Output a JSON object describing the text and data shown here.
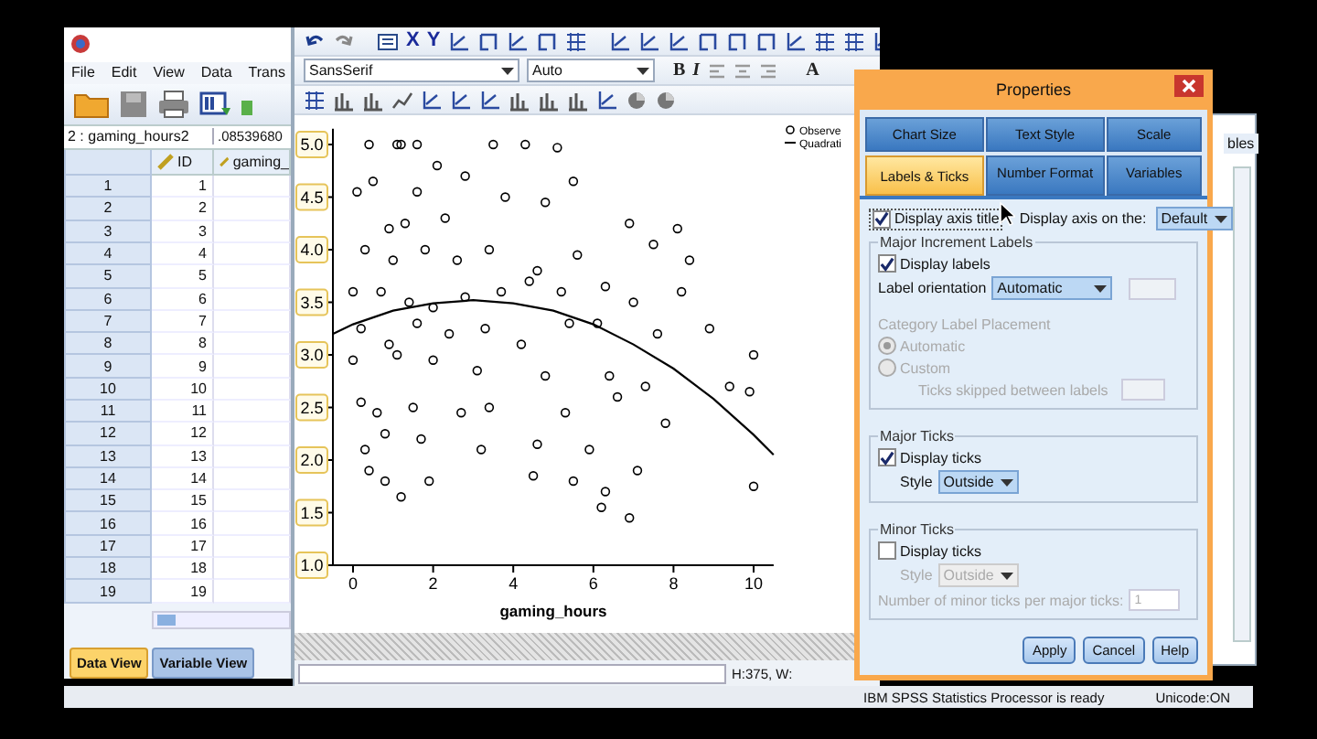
{
  "data_editor": {
    "menu": [
      "File",
      "Edit",
      "View",
      "Data",
      "Trans"
    ],
    "cell_ref": "2 : gaming_hours2",
    "cell_value": ".08539680",
    "columns": [
      "ID",
      "gaming_"
    ],
    "rows": [
      {
        "row": "1",
        "id": "1"
      },
      {
        "row": "2",
        "id": "2"
      },
      {
        "row": "3",
        "id": "3"
      },
      {
        "row": "4",
        "id": "4"
      },
      {
        "row": "5",
        "id": "5"
      },
      {
        "row": "6",
        "id": "6"
      },
      {
        "row": "7",
        "id": "7"
      },
      {
        "row": "8",
        "id": "8"
      },
      {
        "row": "9",
        "id": "9"
      },
      {
        "row": "10",
        "id": "10"
      },
      {
        "row": "11",
        "id": "11"
      },
      {
        "row": "12",
        "id": "12"
      },
      {
        "row": "13",
        "id": "13"
      },
      {
        "row": "14",
        "id": "14"
      },
      {
        "row": "15",
        "id": "15"
      },
      {
        "row": "16",
        "id": "16"
      },
      {
        "row": "17",
        "id": "17"
      },
      {
        "row": "18",
        "id": "18"
      },
      {
        "row": "19",
        "id": "19"
      }
    ],
    "view_tabs": [
      {
        "label": "Data View",
        "selected": true
      },
      {
        "label": "Variable View",
        "selected": false
      }
    ]
  },
  "chart_editor": {
    "axis_buttons": [
      "X",
      "Y"
    ],
    "font": "SansSerif",
    "size": "Auto",
    "style_buttons": [
      "B",
      "I"
    ],
    "color_button": "A",
    "y_labels_selected": true,
    "status": "H:375, W:",
    "chart_data": {
      "type": "scatter",
      "xlabel": "gaming_hours",
      "legend": "top-right",
      "xlim": [
        -0.5,
        10.5
      ],
      "ylim": [
        1,
        5.15
      ],
      "xticks": [
        0,
        2,
        4,
        6,
        8,
        10
      ],
      "yticks": [
        {
          "value": 1,
          "label": "1.0"
        },
        {
          "value": 1.5,
          "label": "1.5"
        },
        {
          "value": 2,
          "label": "2.0"
        },
        {
          "value": 2.5,
          "label": "2.5"
        },
        {
          "value": 3,
          "label": "3.0"
        },
        {
          "value": 3.5,
          "label": "3.5"
        },
        {
          "value": 4,
          "label": "4.0"
        },
        {
          "value": 4.5,
          "label": "4.5"
        },
        {
          "value": 5,
          "label": "5.0"
        }
      ],
      "series": [
        {
          "name": "Observe",
          "type": "scatter",
          "color": "#000000",
          "x": [
            0.4,
            1.1,
            1.2,
            1.6,
            3.5,
            4.3,
            5.1,
            2.1,
            0.1,
            0.5,
            1.6,
            2.8,
            5.5,
            3.8,
            0.9,
            1.3,
            2.3,
            4.8,
            6.9,
            8.1,
            0.3,
            1.0,
            1.8,
            2.6,
            3.4,
            4.6,
            5.6,
            7.5,
            8.4,
            0.0,
            0.7,
            1.4,
            2.0,
            2.8,
            3.7,
            4.4,
            5.2,
            6.3,
            7.0,
            8.2,
            0.2,
            0.9,
            1.6,
            2.4,
            3.3,
            4.2,
            5.4,
            6.1,
            7.6,
            8.9,
            0.0,
            1.1,
            2.0,
            3.1,
            4.8,
            6.4,
            7.3,
            9.4,
            9.9,
            10.0,
            0.2,
            0.6,
            1.5,
            2.7,
            3.4,
            5.3,
            6.6,
            7.8,
            0.3,
            0.8,
            1.7,
            3.2,
            4.6,
            5.9,
            7.1,
            0.4,
            0.8,
            1.9,
            4.5,
            5.5,
            6.3,
            6.2,
            1.2,
            6.9,
            10.0
          ],
          "values": [
            5.0,
            5.0,
            5.0,
            5.0,
            5.0,
            5.0,
            4.97,
            4.8,
            4.55,
            4.65,
            4.55,
            4.7,
            4.65,
            4.5,
            4.2,
            4.25,
            4.3,
            4.45,
            4.25,
            4.2,
            4.0,
            3.9,
            4.0,
            3.9,
            4.0,
            3.8,
            3.95,
            4.05,
            3.9,
            3.6,
            3.6,
            3.5,
            3.45,
            3.55,
            3.6,
            3.7,
            3.6,
            3.65,
            3.5,
            3.6,
            3.25,
            3.1,
            3.3,
            3.2,
            3.25,
            3.1,
            3.3,
            3.3,
            3.2,
            3.25,
            2.95,
            3.0,
            2.95,
            2.85,
            2.8,
            2.8,
            2.7,
            2.7,
            2.65,
            3.0,
            2.55,
            2.45,
            2.5,
            2.45,
            2.5,
            2.45,
            2.6,
            2.35,
            2.1,
            2.25,
            2.2,
            2.1,
            2.15,
            2.1,
            1.9,
            1.9,
            1.8,
            1.8,
            1.85,
            1.8,
            1.7,
            1.55,
            1.65,
            1.45,
            1.75
          ]
        },
        {
          "name": "Quadrati",
          "type": "line",
          "color": "#000000",
          "x": [
            -0.5,
            0,
            1,
            2,
            3,
            4,
            5,
            6,
            7,
            8,
            9,
            10,
            10.5
          ],
          "values": [
            3.2,
            3.29,
            3.42,
            3.49,
            3.52,
            3.49,
            3.42,
            3.29,
            3.1,
            2.87,
            2.58,
            2.24,
            2.05
          ]
        }
      ]
    }
  },
  "background_window": {
    "tab": "bles"
  },
  "properties": {
    "title": "Properties",
    "tab_rows": [
      {
        "tabs": [
          {
            "label": "Chart Size",
            "selected": false
          },
          {
            "label": "Text Style",
            "selected": false
          },
          {
            "label": "Scale",
            "selected": false
          }
        ]
      },
      {
        "tabs": [
          {
            "label": "Labels & Ticks",
            "selected": true
          },
          {
            "label": "Number Format",
            "selected": false
          },
          {
            "label": "Variables",
            "selected": false
          }
        ]
      }
    ],
    "axis_title": {
      "label": "Display axis title",
      "checked": true
    },
    "axis_on": {
      "label": "Display axis on the:",
      "value": "Default"
    },
    "major_labels": {
      "title": "Major Increment Labels",
      "display": {
        "label": "Display labels",
        "checked": true
      },
      "orientation_label": "Label orientation",
      "orientation": "Automatic"
    },
    "category_placement": {
      "title": "Category Label Placement",
      "disabled": true,
      "options": [
        {
          "label": "Automatic",
          "selected": true
        },
        {
          "label": "Custom",
          "selected": false
        }
      ],
      "skip_label": "Ticks skipped between labels"
    },
    "tick_groups": [
      {
        "title": "Major Ticks",
        "display": {
          "label": "Display ticks",
          "checked": true
        },
        "style_label": "Style",
        "style": "Outside",
        "disabled": false
      },
      {
        "title": "Minor Ticks",
        "display": {
          "label": "Display ticks",
          "checked": false
        },
        "style_label": "Style",
        "style": "Outside",
        "disabled": true,
        "count_label": "Number of minor ticks per major ticks:",
        "count": "1"
      }
    ],
    "buttons": [
      "Apply",
      "Cancel",
      "Help"
    ]
  },
  "status_bar": {
    "processor": "IBM SPSS Statistics Processor is ready",
    "unicode": "Unicode:ON"
  }
}
